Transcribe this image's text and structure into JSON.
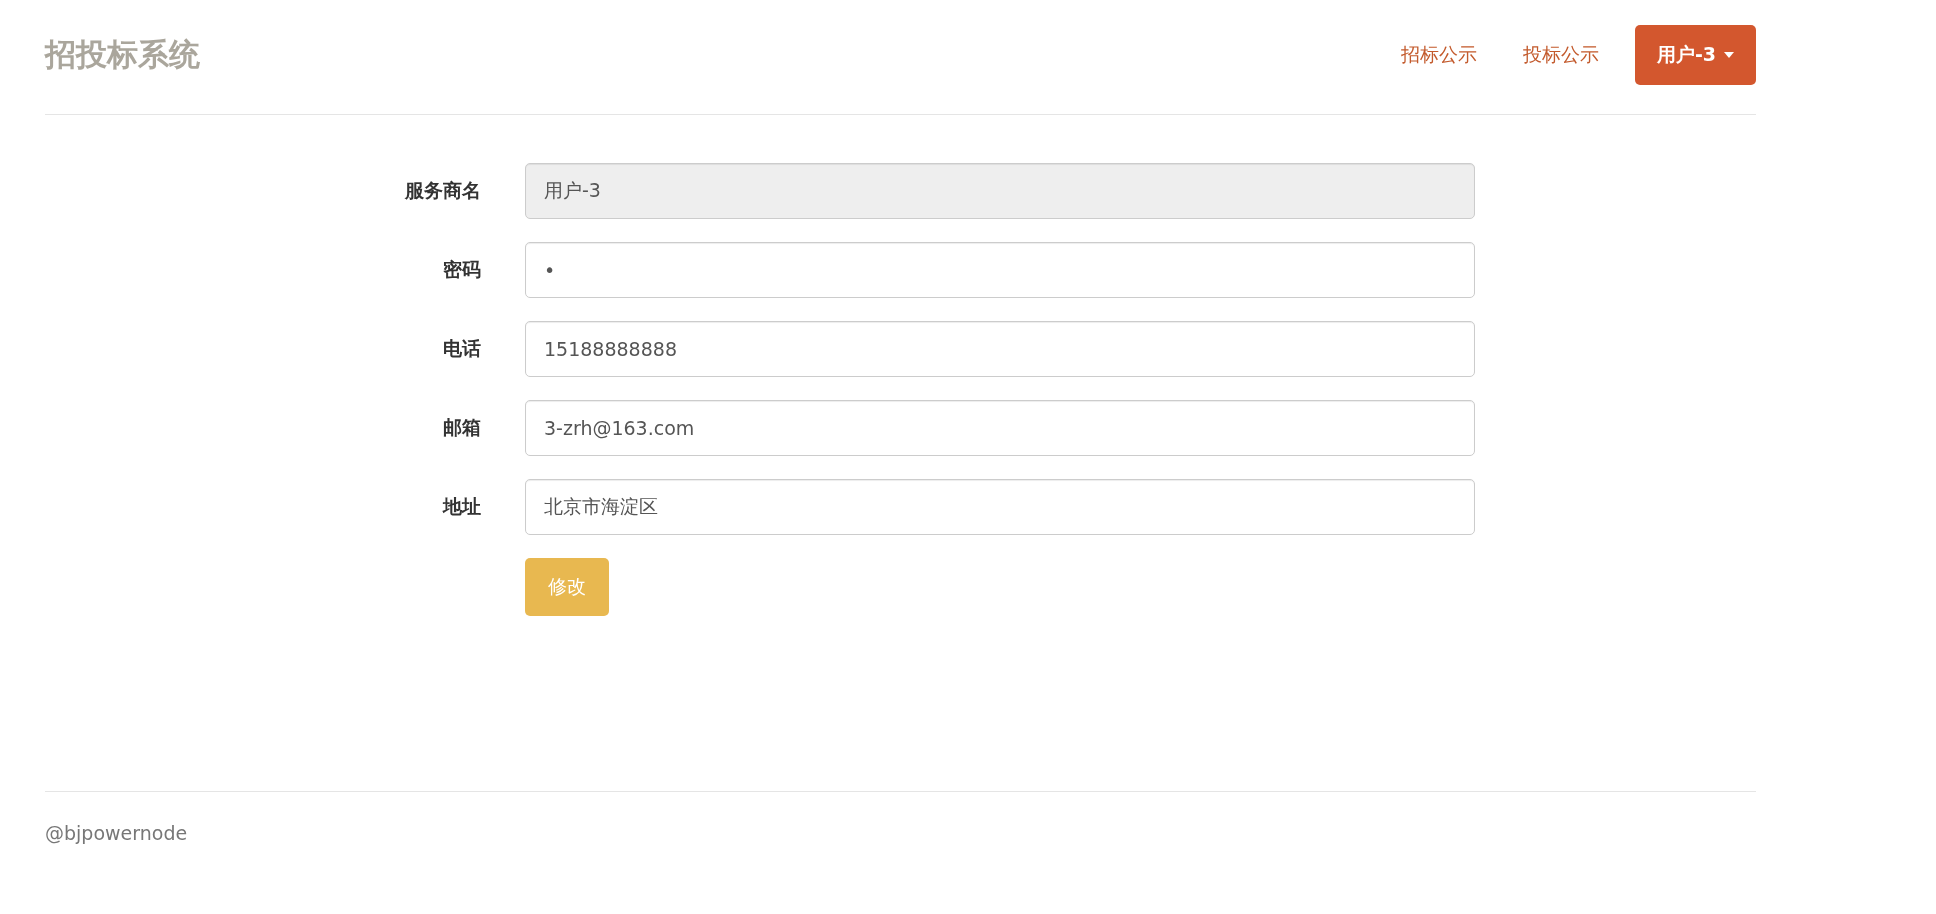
{
  "header": {
    "title": "招投标系统",
    "nav_links": [
      "招标公示",
      "投标公示"
    ],
    "user_menu": {
      "label": "用户-3"
    }
  },
  "form": {
    "fields": [
      {
        "label": "服务商名",
        "value": "用户-3",
        "disabled": true
      },
      {
        "label": "密码",
        "value": "•",
        "disabled": false
      },
      {
        "label": "电话",
        "value": "15188888888",
        "disabled": false
      },
      {
        "label": "邮箱",
        "value": "3-zrh@163.com",
        "disabled": false
      },
      {
        "label": "地址",
        "value": "北京市海淀区",
        "disabled": false
      }
    ],
    "submit": "修改"
  },
  "footer": {
    "text": "@bjpowernode"
  }
}
